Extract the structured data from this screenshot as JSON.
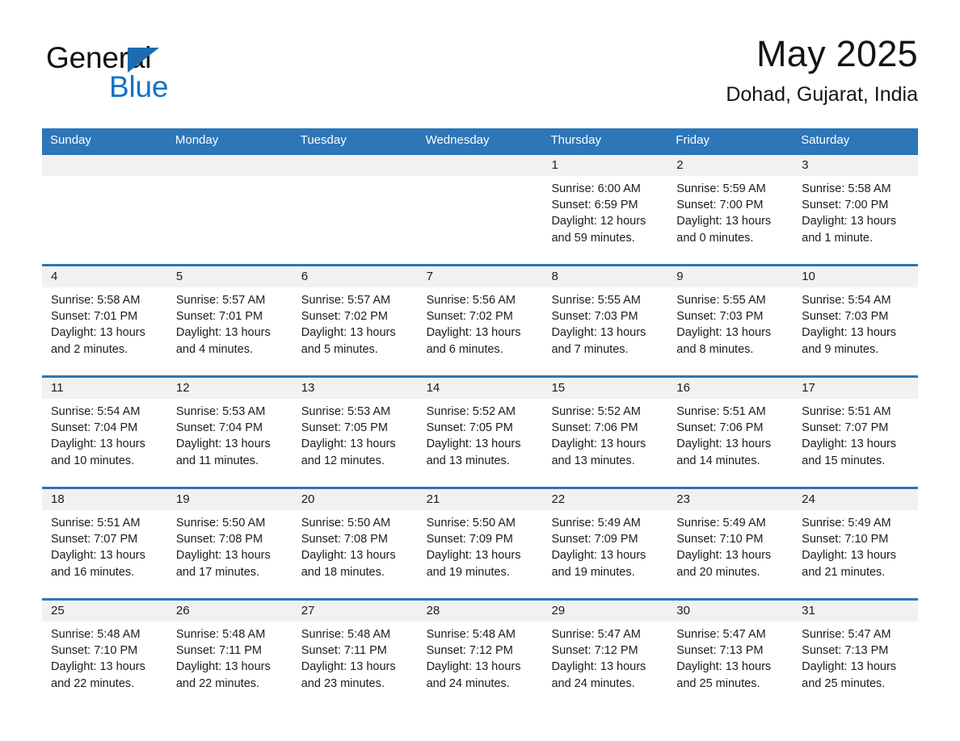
{
  "brand": {
    "name_part1": "General",
    "name_part2": "Blue",
    "logo_icon": "triangle-icon",
    "accent_color": "#1273c4",
    "header_color": "#2d76b8"
  },
  "header": {
    "month_title": "May 2025",
    "location": "Dohad, Gujarat, India"
  },
  "weekdays": [
    "Sunday",
    "Monday",
    "Tuesday",
    "Wednesday",
    "Thursday",
    "Friday",
    "Saturday"
  ],
  "weeks": [
    {
      "days": [
        {
          "num": "",
          "sunrise": "",
          "sunset": "",
          "daylight": "",
          "daylight2": ""
        },
        {
          "num": "",
          "sunrise": "",
          "sunset": "",
          "daylight": "",
          "daylight2": ""
        },
        {
          "num": "",
          "sunrise": "",
          "sunset": "",
          "daylight": "",
          "daylight2": ""
        },
        {
          "num": "",
          "sunrise": "",
          "sunset": "",
          "daylight": "",
          "daylight2": ""
        },
        {
          "num": "1",
          "sunrise": "Sunrise: 6:00 AM",
          "sunset": "Sunset: 6:59 PM",
          "daylight": "Daylight: 12 hours",
          "daylight2": "and 59 minutes."
        },
        {
          "num": "2",
          "sunrise": "Sunrise: 5:59 AM",
          "sunset": "Sunset: 7:00 PM",
          "daylight": "Daylight: 13 hours",
          "daylight2": "and 0 minutes."
        },
        {
          "num": "3",
          "sunrise": "Sunrise: 5:58 AM",
          "sunset": "Sunset: 7:00 PM",
          "daylight": "Daylight: 13 hours",
          "daylight2": "and 1 minute."
        }
      ]
    },
    {
      "days": [
        {
          "num": "4",
          "sunrise": "Sunrise: 5:58 AM",
          "sunset": "Sunset: 7:01 PM",
          "daylight": "Daylight: 13 hours",
          "daylight2": "and 2 minutes."
        },
        {
          "num": "5",
          "sunrise": "Sunrise: 5:57 AM",
          "sunset": "Sunset: 7:01 PM",
          "daylight": "Daylight: 13 hours",
          "daylight2": "and 4 minutes."
        },
        {
          "num": "6",
          "sunrise": "Sunrise: 5:57 AM",
          "sunset": "Sunset: 7:02 PM",
          "daylight": "Daylight: 13 hours",
          "daylight2": "and 5 minutes."
        },
        {
          "num": "7",
          "sunrise": "Sunrise: 5:56 AM",
          "sunset": "Sunset: 7:02 PM",
          "daylight": "Daylight: 13 hours",
          "daylight2": "and 6 minutes."
        },
        {
          "num": "8",
          "sunrise": "Sunrise: 5:55 AM",
          "sunset": "Sunset: 7:03 PM",
          "daylight": "Daylight: 13 hours",
          "daylight2": "and 7 minutes."
        },
        {
          "num": "9",
          "sunrise": "Sunrise: 5:55 AM",
          "sunset": "Sunset: 7:03 PM",
          "daylight": "Daylight: 13 hours",
          "daylight2": "and 8 minutes."
        },
        {
          "num": "10",
          "sunrise": "Sunrise: 5:54 AM",
          "sunset": "Sunset: 7:03 PM",
          "daylight": "Daylight: 13 hours",
          "daylight2": "and 9 minutes."
        }
      ]
    },
    {
      "days": [
        {
          "num": "11",
          "sunrise": "Sunrise: 5:54 AM",
          "sunset": "Sunset: 7:04 PM",
          "daylight": "Daylight: 13 hours",
          "daylight2": "and 10 minutes."
        },
        {
          "num": "12",
          "sunrise": "Sunrise: 5:53 AM",
          "sunset": "Sunset: 7:04 PM",
          "daylight": "Daylight: 13 hours",
          "daylight2": "and 11 minutes."
        },
        {
          "num": "13",
          "sunrise": "Sunrise: 5:53 AM",
          "sunset": "Sunset: 7:05 PM",
          "daylight": "Daylight: 13 hours",
          "daylight2": "and 12 minutes."
        },
        {
          "num": "14",
          "sunrise": "Sunrise: 5:52 AM",
          "sunset": "Sunset: 7:05 PM",
          "daylight": "Daylight: 13 hours",
          "daylight2": "and 13 minutes."
        },
        {
          "num": "15",
          "sunrise": "Sunrise: 5:52 AM",
          "sunset": "Sunset: 7:06 PM",
          "daylight": "Daylight: 13 hours",
          "daylight2": "and 13 minutes."
        },
        {
          "num": "16",
          "sunrise": "Sunrise: 5:51 AM",
          "sunset": "Sunset: 7:06 PM",
          "daylight": "Daylight: 13 hours",
          "daylight2": "and 14 minutes."
        },
        {
          "num": "17",
          "sunrise": "Sunrise: 5:51 AM",
          "sunset": "Sunset: 7:07 PM",
          "daylight": "Daylight: 13 hours",
          "daylight2": "and 15 minutes."
        }
      ]
    },
    {
      "days": [
        {
          "num": "18",
          "sunrise": "Sunrise: 5:51 AM",
          "sunset": "Sunset: 7:07 PM",
          "daylight": "Daylight: 13 hours",
          "daylight2": "and 16 minutes."
        },
        {
          "num": "19",
          "sunrise": "Sunrise: 5:50 AM",
          "sunset": "Sunset: 7:08 PM",
          "daylight": "Daylight: 13 hours",
          "daylight2": "and 17 minutes."
        },
        {
          "num": "20",
          "sunrise": "Sunrise: 5:50 AM",
          "sunset": "Sunset: 7:08 PM",
          "daylight": "Daylight: 13 hours",
          "daylight2": "and 18 minutes."
        },
        {
          "num": "21",
          "sunrise": "Sunrise: 5:50 AM",
          "sunset": "Sunset: 7:09 PM",
          "daylight": "Daylight: 13 hours",
          "daylight2": "and 19 minutes."
        },
        {
          "num": "22",
          "sunrise": "Sunrise: 5:49 AM",
          "sunset": "Sunset: 7:09 PM",
          "daylight": "Daylight: 13 hours",
          "daylight2": "and 19 minutes."
        },
        {
          "num": "23",
          "sunrise": "Sunrise: 5:49 AM",
          "sunset": "Sunset: 7:10 PM",
          "daylight": "Daylight: 13 hours",
          "daylight2": "and 20 minutes."
        },
        {
          "num": "24",
          "sunrise": "Sunrise: 5:49 AM",
          "sunset": "Sunset: 7:10 PM",
          "daylight": "Daylight: 13 hours",
          "daylight2": "and 21 minutes."
        }
      ]
    },
    {
      "days": [
        {
          "num": "25",
          "sunrise": "Sunrise: 5:48 AM",
          "sunset": "Sunset: 7:10 PM",
          "daylight": "Daylight: 13 hours",
          "daylight2": "and 22 minutes."
        },
        {
          "num": "26",
          "sunrise": "Sunrise: 5:48 AM",
          "sunset": "Sunset: 7:11 PM",
          "daylight": "Daylight: 13 hours",
          "daylight2": "and 22 minutes."
        },
        {
          "num": "27",
          "sunrise": "Sunrise: 5:48 AM",
          "sunset": "Sunset: 7:11 PM",
          "daylight": "Daylight: 13 hours",
          "daylight2": "and 23 minutes."
        },
        {
          "num": "28",
          "sunrise": "Sunrise: 5:48 AM",
          "sunset": "Sunset: 7:12 PM",
          "daylight": "Daylight: 13 hours",
          "daylight2": "and 24 minutes."
        },
        {
          "num": "29",
          "sunrise": "Sunrise: 5:47 AM",
          "sunset": "Sunset: 7:12 PM",
          "daylight": "Daylight: 13 hours",
          "daylight2": "and 24 minutes."
        },
        {
          "num": "30",
          "sunrise": "Sunrise: 5:47 AM",
          "sunset": "Sunset: 7:13 PM",
          "daylight": "Daylight: 13 hours",
          "daylight2": "and 25 minutes."
        },
        {
          "num": "31",
          "sunrise": "Sunrise: 5:47 AM",
          "sunset": "Sunset: 7:13 PM",
          "daylight": "Daylight: 13 hours",
          "daylight2": "and 25 minutes."
        }
      ]
    }
  ]
}
